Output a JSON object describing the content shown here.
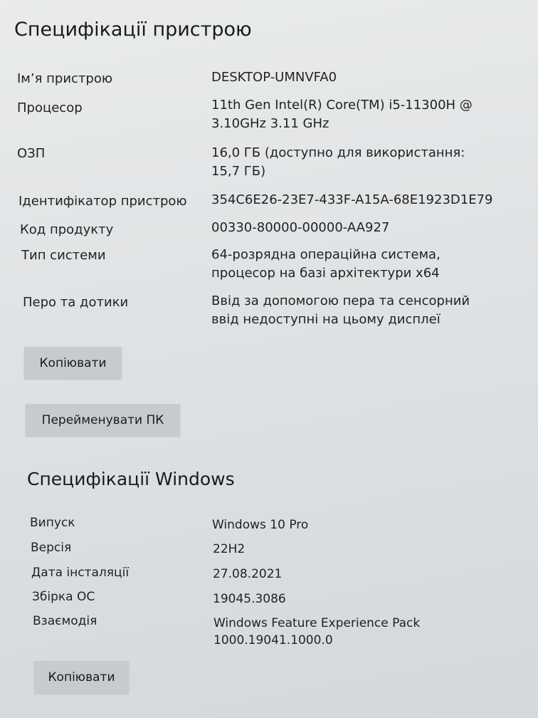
{
  "device_specs": {
    "title": "Специфікації пристрою",
    "rows": [
      {
        "label": "Ім’я пристрою",
        "value": "DESKTOP-UMNVFA0"
      },
      {
        "label": "Процесор",
        "value": "11th Gen Intel(R) Core(TM) i5-11300H @ 3.10GHz   3.11 GHz"
      },
      {
        "label": "ОЗП",
        "value": "16,0 ГБ (доступно для використання: 15,7 ГБ)"
      },
      {
        "label": "Ідентифікатор пристрою",
        "value": "354C6E26-23E7-433F-A15A-68E1923D1E79"
      },
      {
        "label": "Код продукту",
        "value": "00330-80000-00000-AA927"
      },
      {
        "label": "Тип системи",
        "value": "64-розрядна операційна система, процесор на базі архітектури x64"
      },
      {
        "label": "Перо та дотики",
        "value": "Ввід за допомогою пера та сенсорний ввід недоступні на цьому дисплеї"
      }
    ],
    "copy_button": "Копіювати",
    "rename_button": "Перейменувати ПК"
  },
  "windows_specs": {
    "title": "Специфікації Windows",
    "rows": [
      {
        "label": "Випуск",
        "value": "Windows 10 Pro"
      },
      {
        "label": "Версія",
        "value": "22H2"
      },
      {
        "label": "Дата інсталяції",
        "value": "27.08.2021"
      },
      {
        "label": "Збірка ОС",
        "value": "19045.3086"
      },
      {
        "label": "Взаємодія",
        "value": "Windows Feature Experience Pack 1000.19041.1000.0"
      }
    ],
    "copy_button": "Копіювати"
  },
  "colors": {
    "background": "#e3e6e8",
    "button": "#c8cbcd",
    "link": "#5b7fb0"
  }
}
